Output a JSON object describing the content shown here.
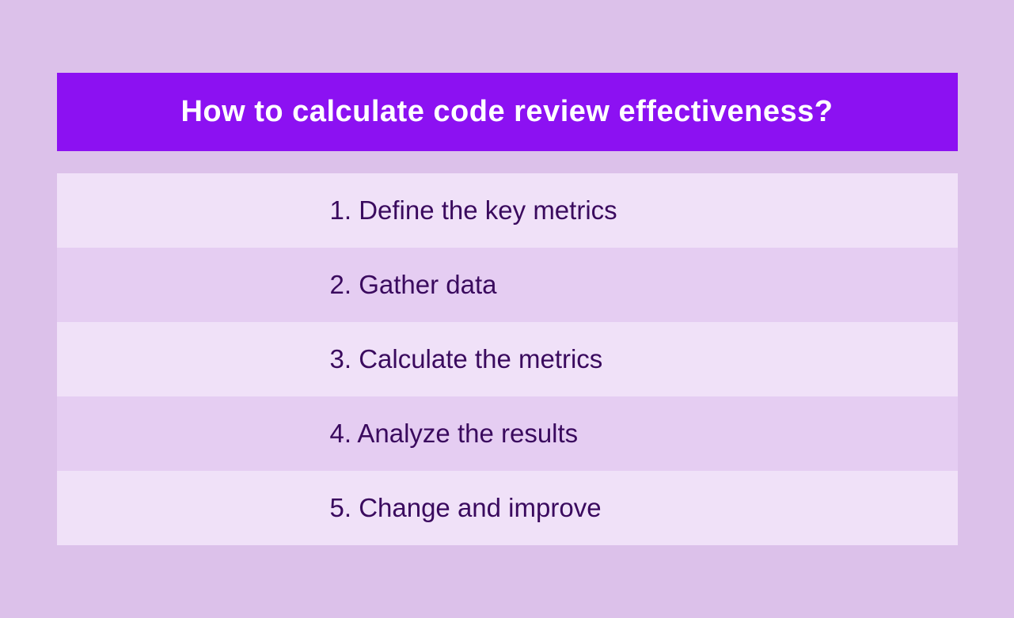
{
  "title": "How to calculate code review effectiveness?",
  "steps": [
    "1. Define the key metrics",
    "2. Gather data",
    "3. Calculate the metrics",
    "4. Analyze the results",
    "5. Change and improve"
  ]
}
